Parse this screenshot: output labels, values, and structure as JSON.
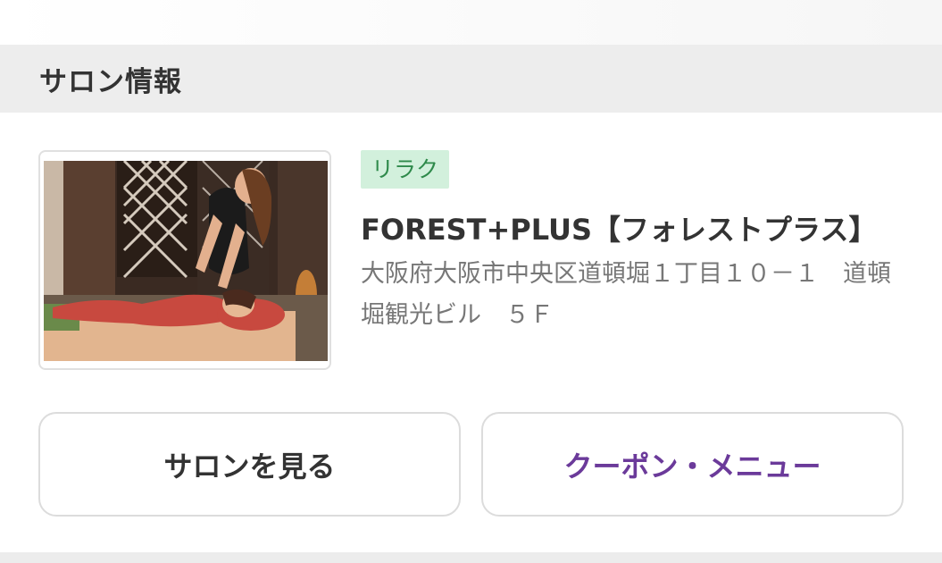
{
  "section": {
    "title": "サロン情報"
  },
  "salon": {
    "category": "リラク",
    "name": "FOREST+PLUS【フォレストプラス】",
    "address": "大阪府大阪市中央区道頓堀１丁目１０－１　道頓堀観光ビル　５Ｆ"
  },
  "buttons": {
    "view_salon": "サロンを見る",
    "coupon_menu": "クーポン・メニュー"
  },
  "colors": {
    "badge_bg": "#d2f0dc",
    "badge_text": "#2f8a4b",
    "coupon_text": "#6b3a9a",
    "header_bg": "#ededed"
  }
}
